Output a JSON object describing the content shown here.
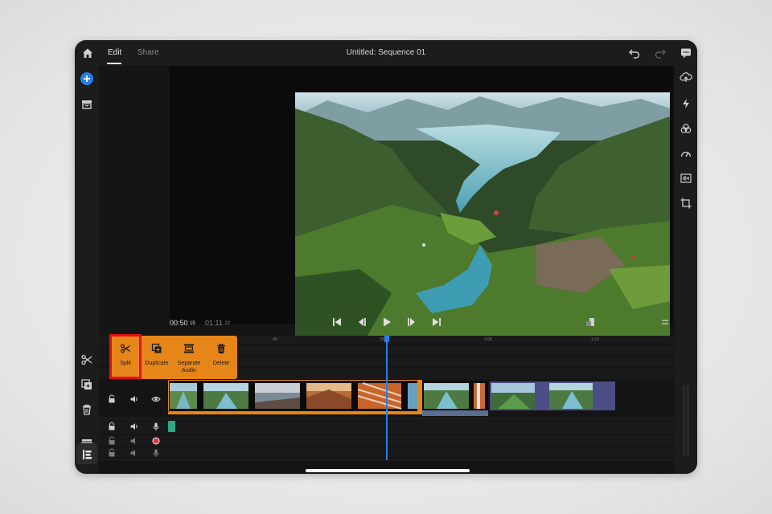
{
  "tabs": {
    "edit": "Edit",
    "share": "Share"
  },
  "title": "Untitled: Sequence 01",
  "timecode": {
    "current": "00:50",
    "current_frames": "15",
    "total": "01:11",
    "total_frames": "22"
  },
  "ruler": [
    ":40",
    "50",
    "1:00",
    "1:10"
  ],
  "context_menu": {
    "split": "Split",
    "duplicate": "Duplicate",
    "separate_audio_line1": "Separate",
    "separate_audio_line2": "Audio",
    "delete": "Delete"
  },
  "colors": {
    "accent_orange": "#e68619",
    "playhead_blue": "#2680eb",
    "highlight_red": "#e1101a"
  }
}
